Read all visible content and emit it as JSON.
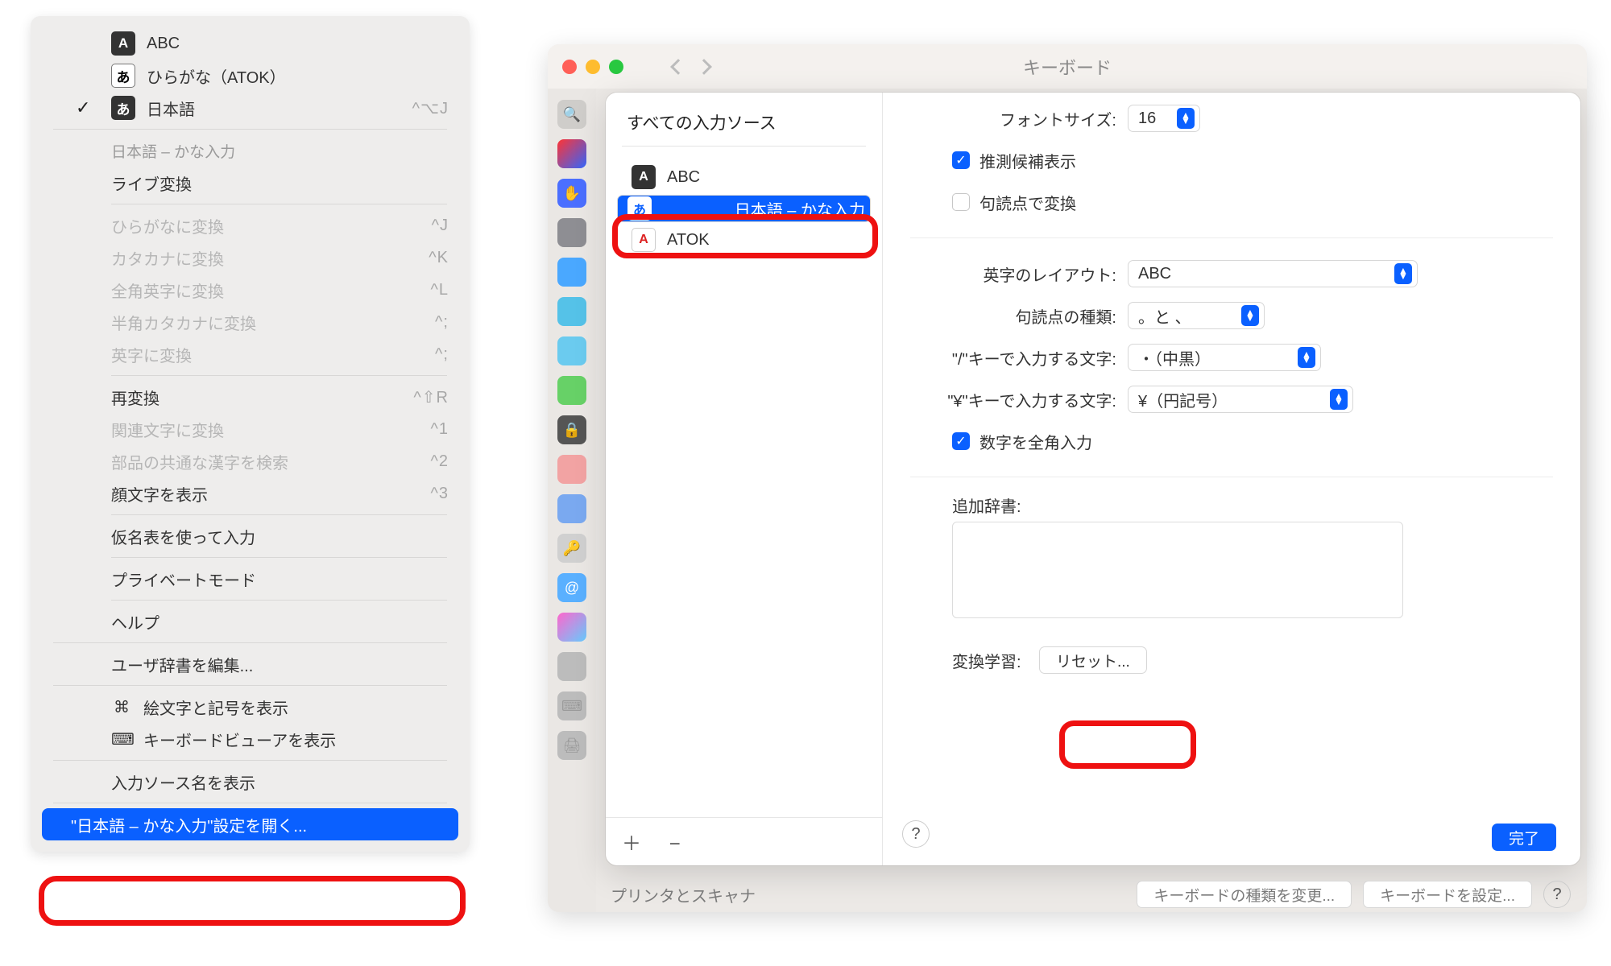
{
  "menu": {
    "sources": [
      {
        "icon": "A",
        "style": "black",
        "label": "ABC",
        "checked": false,
        "shortcut": ""
      },
      {
        "icon": "あ",
        "style": "white",
        "label": "ひらがな（ATOK）",
        "checked": false,
        "shortcut": ""
      },
      {
        "icon": "あ",
        "style": "black",
        "label": "日本語",
        "checked": true,
        "shortcut": "^⌥J"
      }
    ],
    "section": "日本語 – かな入力",
    "live_convert": "ライブ変換",
    "convert_rows": [
      {
        "label": "ひらがなに変換",
        "shortcut": "^J",
        "disabled": true
      },
      {
        "label": "カタカナに変換",
        "shortcut": "^K",
        "disabled": true
      },
      {
        "label": "全角英字に変換",
        "shortcut": "^L",
        "disabled": true
      },
      {
        "label": "半角カタカナに変換",
        "shortcut": "^;",
        "disabled": true
      },
      {
        "label": "英字に変換",
        "shortcut": "^;",
        "disabled": true
      }
    ],
    "reconvert": {
      "label": "再変換",
      "shortcut": "^⇧R"
    },
    "related": {
      "label": "関連文字に変換",
      "shortcut": "^1",
      "disabled": true
    },
    "kanji": {
      "label": "部品の共通な漢字を検索",
      "shortcut": "^2",
      "disabled": true
    },
    "kaomoji": {
      "label": "顔文字を表示",
      "shortcut": "^3"
    },
    "kana_table": "仮名表を使って入力",
    "private": "プライベートモード",
    "help": "ヘルプ",
    "user_dict": "ユーザ辞書を編集...",
    "emoji": "絵文字と記号を表示",
    "kbd_viewer": "キーボードビューアを表示",
    "src_names": "入力ソース名を表示",
    "open_pref": "\"日本語 – かな入力\"設定を開く..."
  },
  "syswin": {
    "title": "キーボード",
    "sidebar_footer": "プリンタとスキャナ",
    "footer_btns": [
      "キーボードの種類を変更...",
      "キーボードを設定..."
    ]
  },
  "sheet": {
    "header": "すべての入力ソース",
    "sources": [
      {
        "icon": "A",
        "style": "dark",
        "label": "ABC",
        "selected": false
      },
      {
        "icon": "あ",
        "style": "selwhite",
        "label": "日本語 – かな入力",
        "selected": true
      },
      {
        "icon": "A",
        "style": "red",
        "label": "ATOK",
        "selected": false
      }
    ],
    "plus_minus": "＋  −",
    "form": {
      "font_size_label": "フォントサイズ:",
      "font_size_value": "16",
      "suggest_label": "推測候補表示",
      "suggest_on": true,
      "punct_convert_label": "句読点で変換",
      "punct_convert_on": false,
      "layout_label": "英字のレイアウト:",
      "layout_value": "ABC",
      "punct_type_label": "句読点の種類:",
      "punct_type_value": "。と 、",
      "slash_label": "\"/\"キーで入力する文字:",
      "slash_value": "・（中黒）",
      "yen_label": "\"¥\"キーで入力する文字:",
      "yen_value": "¥（円記号）",
      "fullwidth_num_label": "数字を全角入力",
      "fullwidth_num_on": true,
      "extra_dict_label": "追加辞書:",
      "learn_label": "変換学習:",
      "reset_btn": "リセット...",
      "done_btn": "完了"
    }
  }
}
